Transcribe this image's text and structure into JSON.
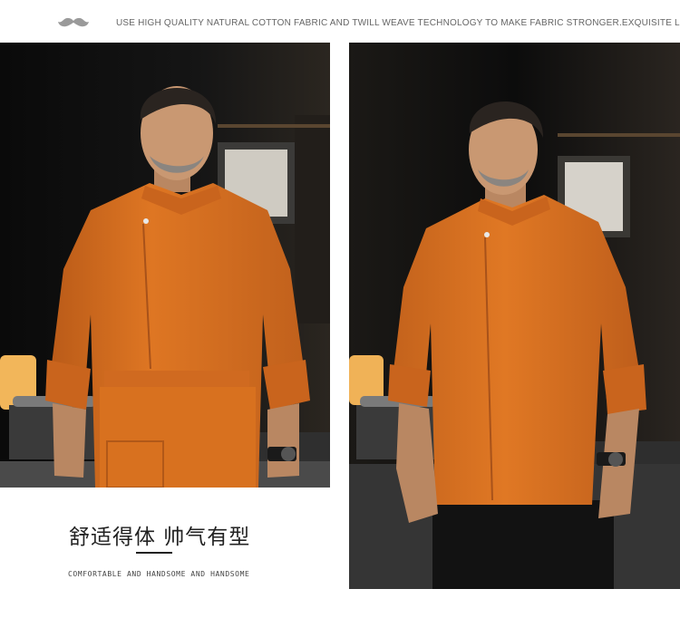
{
  "header": {
    "tagline": "USE HIGH QUALITY NATURAL COTTON FABRIC AND TWILL WEAVE TECHNOLOGY TO MAKE FABRIC STRONGER.EXQUISITE LINE."
  },
  "caption": {
    "title": "舒适得体  帅气有型",
    "subtitle": "COMFORTABLE AND HANDSOME AND HANDSOME"
  },
  "colors": {
    "jacket": "#d96f1f",
    "jacket_shadow": "#b1561a",
    "background": "#0b0b0c",
    "skin": "#c99872"
  },
  "icons": {
    "brand": "mustache-icon"
  }
}
